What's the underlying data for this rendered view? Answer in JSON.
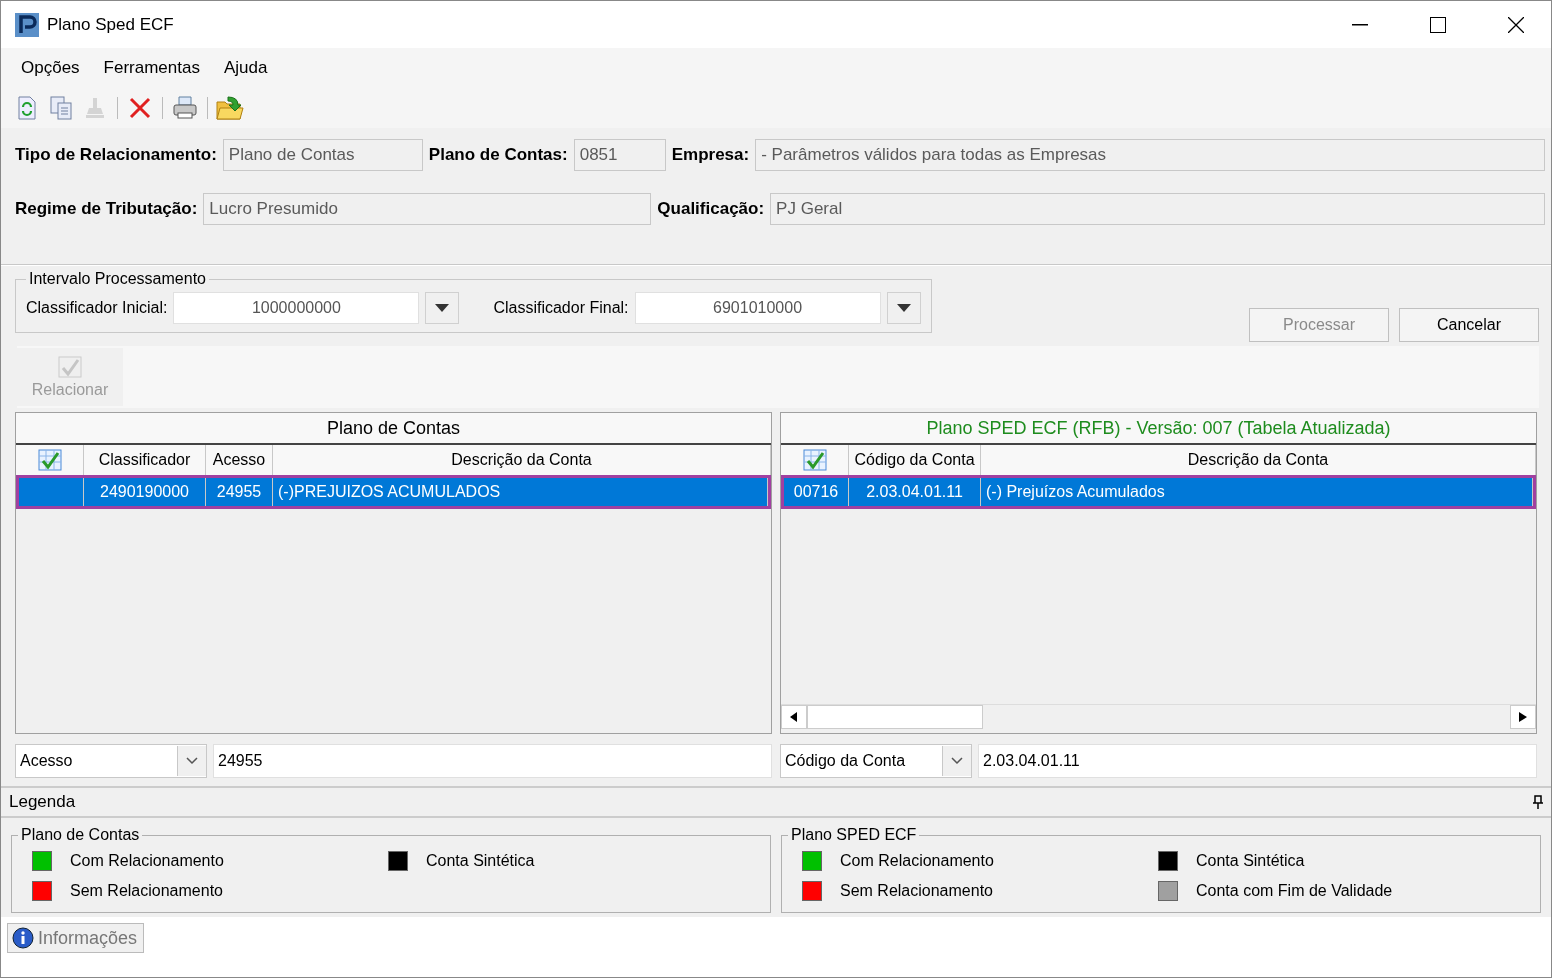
{
  "window": {
    "title": "Plano Sped ECF"
  },
  "menu": [
    "Opções",
    "Ferramentas",
    "Ajuda"
  ],
  "toolbar": [
    {
      "kind": "refresh",
      "disabled": false
    },
    {
      "kind": "copy",
      "disabled": false
    },
    {
      "kind": "stamp",
      "disabled": true
    },
    {
      "kind": "separator"
    },
    {
      "kind": "delete",
      "disabled": false
    },
    {
      "kind": "separator"
    },
    {
      "kind": "print",
      "disabled": false
    },
    {
      "kind": "separator"
    },
    {
      "kind": "import",
      "disabled": false
    }
  ],
  "filter_rows": [
    [
      {
        "label": "Tipo de Relacionamento:",
        "value": "Plano de Contas"
      },
      {
        "label": "Plano de Contas:",
        "value": "0851"
      },
      {
        "label": "Empresa:",
        "value": "- Parâmetros válidos para todas as Empresas"
      }
    ],
    [
      {
        "label": "Regime de Tributação:",
        "value": "Lucro Presumido"
      },
      {
        "label": "Qualificação:",
        "value": "PJ Geral"
      }
    ]
  ],
  "interval": {
    "title": "Intervalo Processamento",
    "fields": [
      {
        "label": "Classificador Inicial:",
        "value": "1000000000"
      },
      {
        "label": "Classificador Final:",
        "value": "6901010000"
      }
    ]
  },
  "actions": [
    {
      "label": "Processar",
      "disabled": true
    },
    {
      "label": "Cancelar",
      "disabled": false
    }
  ],
  "relate_button": {
    "label": "Relacionar",
    "disabled": true
  },
  "grids": [
    {
      "title": "Plano de Contas",
      "color": "#000000",
      "scrollbar": false,
      "columns": [
        {
          "kind": "icon"
        },
        {
          "kind": "text",
          "label": "Classificador"
        },
        {
          "kind": "text",
          "label": "Acesso"
        },
        {
          "kind": "text",
          "label": "Descrição da Conta"
        }
      ],
      "rows": [
        {
          "selected": true,
          "cells": [
            null,
            "2490190000",
            "24955",
            "(-)PREJUIZOS ACUMULADOS"
          ]
        }
      ],
      "search": {
        "field": "Acesso",
        "value": "24955"
      }
    },
    {
      "title": "Plano SPED ECF (RFB) - Versão: 007 (Tabela Atualizada)",
      "color": "#1e8c1e",
      "scrollbar": true,
      "columns": [
        {
          "kind": "icon"
        },
        {
          "kind": "text",
          "label": "Código da Conta"
        },
        {
          "kind": "text",
          "label": "Descrição da Conta"
        }
      ],
      "rows": [
        {
          "selected": true,
          "cells": [
            "00716",
            "2.03.04.01.11",
            "(-) Prejuízos Acumulados"
          ]
        }
      ],
      "search": {
        "field": "Código da Conta",
        "value": "2.03.04.01.11"
      }
    }
  ],
  "legend": {
    "title": "Legenda",
    "groups": [
      {
        "title": "Plano de Contas",
        "items": [
          {
            "label": "Com Relacionamento",
            "color": "#00c000"
          },
          {
            "label": "Sem Relacionamento",
            "color": "#ff0000"
          },
          {
            "label": "Conta Sintética",
            "color": "#000000"
          }
        ]
      },
      {
        "title": "Plano SPED ECF",
        "items": [
          {
            "label": "Com Relacionamento",
            "color": "#00c000"
          },
          {
            "label": "Sem Relacionamento",
            "color": "#ff0000"
          },
          {
            "label": "Conta Sintética",
            "color": "#000000"
          },
          {
            "label": "Conta com Fim de Validade",
            "color": "#a0a0a0"
          }
        ]
      }
    ]
  },
  "status_tab": {
    "label": "Informações"
  }
}
